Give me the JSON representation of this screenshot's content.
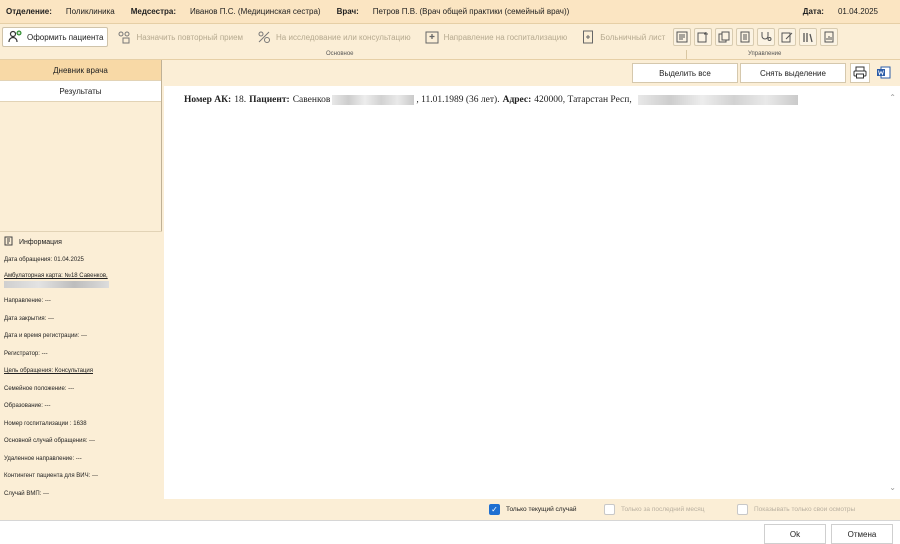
{
  "header": {
    "department_label": "Отделение:",
    "department": "Поликлиника",
    "nurse_label": "Медсестра:",
    "nurse": "Иванов П.С. (Медицинская сестра)",
    "doctor_label": "Врач:",
    "doctor": "Петров П.В. (Врач общей практики (семейный врач))",
    "date_label": "Дата:",
    "date": "01.04.2025"
  },
  "toolbar": {
    "register_patient": "Оформить пациента",
    "repeat_visit": "Назначить повторный прием",
    "exam_referral": "На исследование или консультацию",
    "hosp_referral": "Направление на госпитализацию",
    "sick_leave": "Больничный лист",
    "group_main": "Основное",
    "group_manage": "Управление"
  },
  "sidebar": {
    "tabs": [
      "Дневник врача",
      "Результаты"
    ],
    "info_title": "Информация",
    "lines": [
      "Дата обращения: 01.04.2025",
      "Амбулаторная карта: №18 Савенков,",
      "Направление: ---",
      "Дата закрытия: ---",
      "Дата и время регистрации: ---",
      "Регистратор: ---",
      "Цель обращения: Консультация",
      "Семейное положение: ---",
      "Образование: ---",
      "Номер госпитализации : 1638",
      "Основной случай обращения: ---",
      "Удаленное направление: ---",
      "Контингент пациента для ВИЧ: ---",
      "Случай ВМП: ---"
    ]
  },
  "main": {
    "select_all": "Выделить все",
    "deselect": "Снять выделение",
    "record": {
      "ak_label": "Номер АК:",
      "ak_value": "18.",
      "patient_label": "Пациент:",
      "patient_name": "Савенков",
      "birth": ", 11.01.1989 (36 лет).",
      "address_label": "Адрес:",
      "address": "420000, Татарстан Респ,"
    },
    "only_current": "Только текущий случай",
    "last_month": "Только за последний месяц",
    "own_exams": "Показывать только свои осмотры"
  },
  "footer": {
    "ok": "Ok",
    "cancel": "Отмена"
  }
}
